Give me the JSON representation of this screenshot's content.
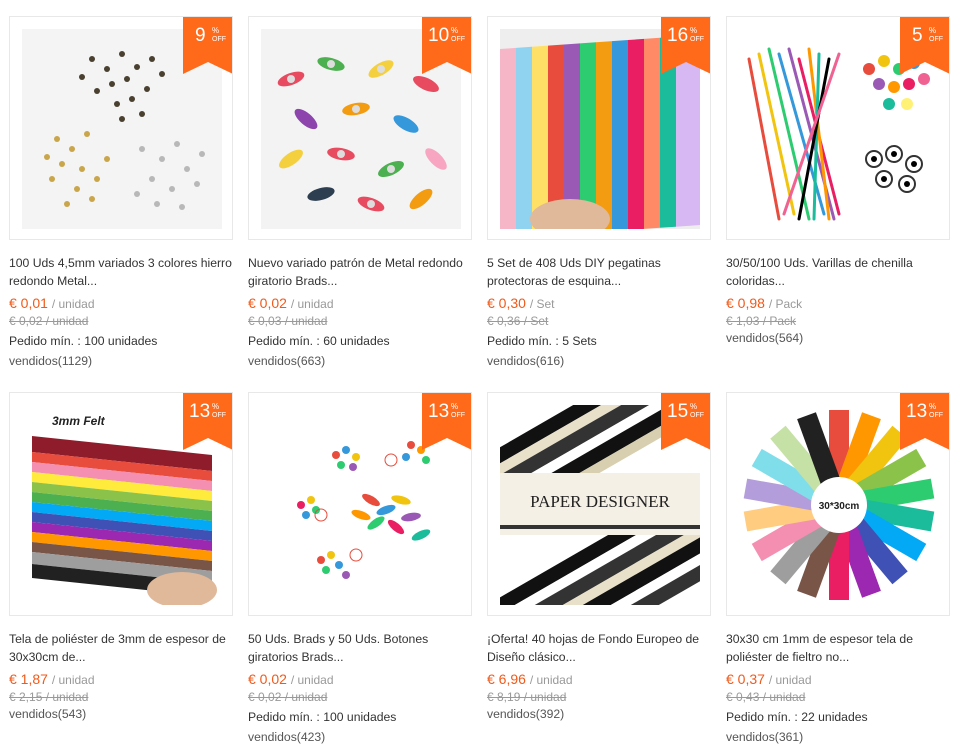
{
  "colors": {
    "accent": "#f05a1a",
    "badge": "#ff6a1a"
  },
  "products": [
    {
      "discount": "9",
      "title": "100 Uds 4,5mm variados 3 colores hierro redondo Metal...",
      "price": "€ 0,01",
      "unit": "/ unidad",
      "old_price": "€ 0,02 / unidad",
      "min_order": "Pedido mín. : 100 unidades",
      "sold": "vendidos(1129)",
      "image": "brads-metal"
    },
    {
      "discount": "10",
      "title": "Nuevo variado patrón de Metal redondo giratorio Brads...",
      "price": "€ 0,02",
      "unit": "/ unidad",
      "old_price": "€ 0,03 / unidad",
      "min_order": "Pedido mín. : 60 unidades",
      "sold": "vendidos(663)",
      "image": "brads-leaf"
    },
    {
      "discount": "16",
      "title": "5 Set de 408 Uds DIY pegatinas protectoras de esquina...",
      "price": "€ 0,30",
      "unit": "/ Set",
      "old_price": "€ 0,36 / Set",
      "min_order": "Pedido mín. : 5 Sets",
      "sold": "vendidos(616)",
      "image": "corner-stickers"
    },
    {
      "discount": "5",
      "title": "30/50/100 Uds. Varillas de chenilla coloridas...",
      "price": "€ 0,98",
      "unit": "/ Pack",
      "old_price": "€ 1,03 / Pack",
      "min_order": "",
      "sold": "vendidos(564)",
      "image": "chenille"
    },
    {
      "discount": "13",
      "title": "Tela de poliéster de 3mm de espesor de 30x30cm de...",
      "price": "€ 1,87",
      "unit": "/ unidad",
      "old_price": "€ 2,15 / unidad",
      "min_order": "",
      "sold": "vendidos(543)",
      "image": "felt-3mm",
      "image_text": "3mm Felt"
    },
    {
      "discount": "13",
      "title": "50 Uds. Brads y 50 Uds. Botones giratorios Brads...",
      "price": "€ 0,02",
      "unit": "/ unidad",
      "old_price": "€ 0,02 / unidad",
      "min_order": "Pedido mín. : 100 unidades",
      "sold": "vendidos(423)",
      "image": "brads-mixed"
    },
    {
      "discount": "15",
      "title": "¡Oferta! 40 hojas de Fondo Europeo de Diseño clásico...",
      "price": "€ 6,96",
      "unit": "/ unidad",
      "old_price": "€ 8,19 / unidad",
      "min_order": "",
      "sold": "vendidos(392)",
      "image": "paper-designer",
      "image_text": "PAPER DESIGNER"
    },
    {
      "discount": "13",
      "title": "30x30 cm 1mm de espesor tela de poliéster de fieltro no...",
      "price": "€ 0,37",
      "unit": "/ unidad",
      "old_price": "€ 0,43 / unidad",
      "min_order": "Pedido mín. : 22 unidades",
      "sold": "vendidos(361)",
      "image": "felt-fan",
      "image_text": "30*30cm"
    }
  ],
  "badge_pct": "%",
  "badge_off": "OFF"
}
